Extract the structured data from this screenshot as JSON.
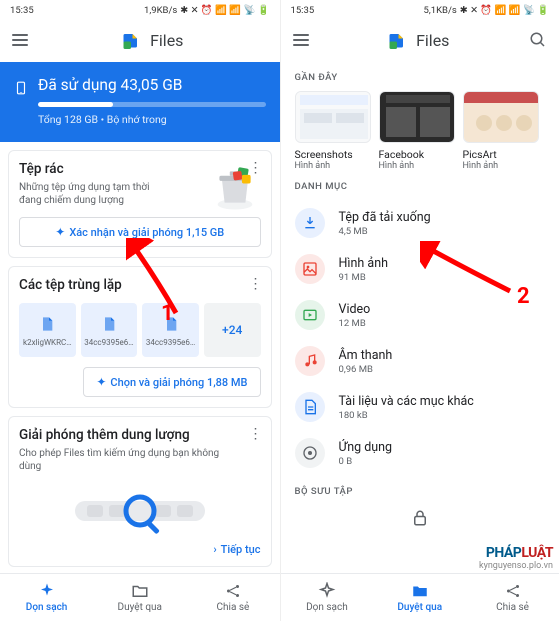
{
  "status": {
    "time": "15:35",
    "speed_left": "1,9KB/s",
    "speed_right": "5,1KB/s",
    "icons": "⁂ ✕ ⌀ 📶 📶 📶 🔋"
  },
  "app": {
    "title": "Files"
  },
  "storage": {
    "title": "Đã sử dụng 43,05 GB",
    "sub": "Tổng 128 GB • Bộ nhớ trong",
    "progress_pct": 33
  },
  "trash_card": {
    "title": "Tệp rác",
    "sub": "Những tệp ứng dụng tạm thời đang chiếm dung lượng",
    "action": "Xác nhận và giải phóng 1,15 GB"
  },
  "dup_card": {
    "title": "Các tệp trùng lặp",
    "items": [
      "k2xligWKRC…",
      "34cc9395e6…",
      "34cc9395e6…"
    ],
    "more": "+24",
    "action": "Chọn và giải phóng 1,88 MB"
  },
  "free_card": {
    "title": "Giải phóng thêm dung lượng",
    "sub": "Cho phép Files tìm kiếm ứng dụng bạn không dùng",
    "action": "Tiếp tục"
  },
  "nav": {
    "clean": "Dọn sạch",
    "browse": "Duyệt qua",
    "share": "Chia sẻ"
  },
  "right": {
    "recent_label": "GẦN ĐÂY",
    "recent": [
      {
        "name": "Screenshots",
        "type": "Hình ảnh"
      },
      {
        "name": "Facebook",
        "type": "Hình ảnh"
      },
      {
        "name": "PicsArt",
        "type": "Hình ảnh"
      }
    ],
    "cat_label": "DANH MỤC",
    "categories": [
      {
        "name": "Tệp đã tải xuống",
        "size": "4,5 MB",
        "icon": "download",
        "color": "#1a73e8"
      },
      {
        "name": "Hình ảnh",
        "size": "91 MB",
        "icon": "image",
        "color": "#ea4335"
      },
      {
        "name": "Video",
        "size": "12 MB",
        "icon": "video",
        "color": "#34a853"
      },
      {
        "name": "Âm thanh",
        "size": "0,96 MB",
        "icon": "audio",
        "color": "#ea4335"
      },
      {
        "name": "Tài liệu và các mục khác",
        "size": "180 kB",
        "icon": "doc",
        "color": "#1a73e8"
      },
      {
        "name": "Ứng dụng",
        "size": "0 B",
        "icon": "app",
        "color": "#5f6368"
      }
    ],
    "collection_label": "BỘ SƯU TẬP"
  },
  "annotations": {
    "one": "1",
    "two": "2"
  },
  "watermark": {
    "brand_a": "PHÁP",
    "brand_b": "LUẬT",
    "sub": "kynguyenso.plo.vn"
  }
}
